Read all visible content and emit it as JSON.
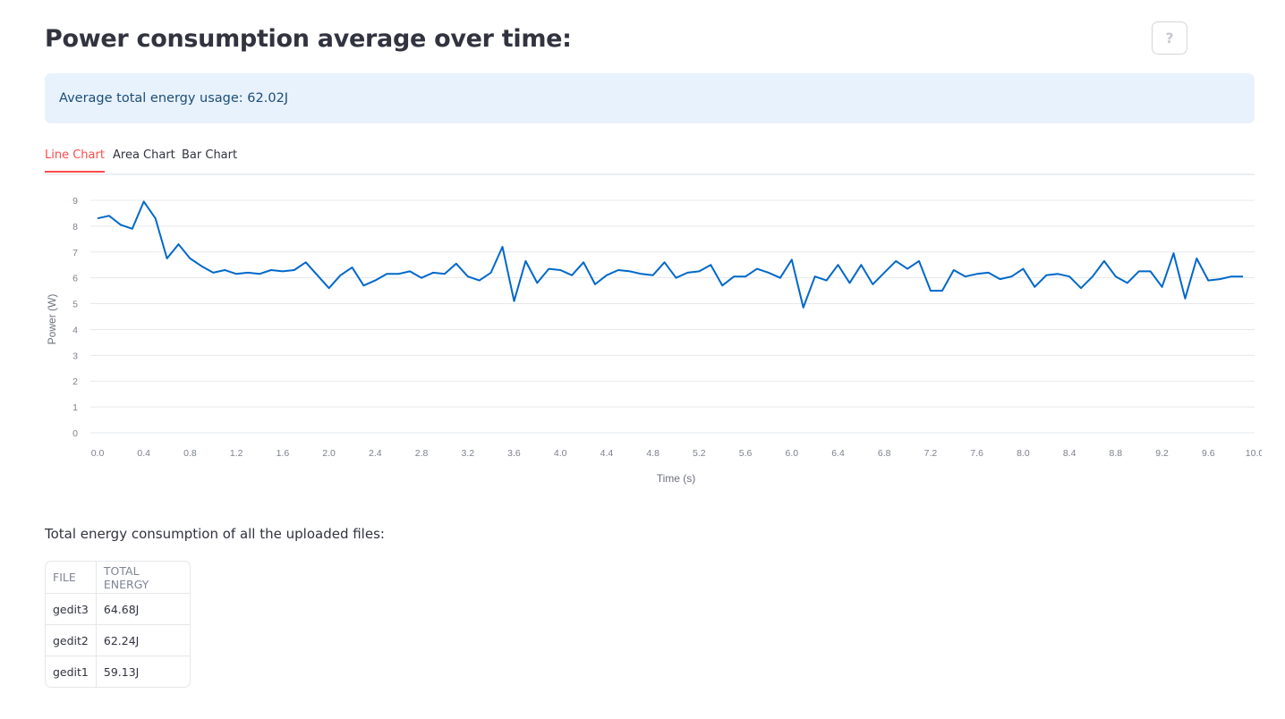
{
  "page": {
    "title": "Power consumption average over time:",
    "help_icon": "question-mark-icon",
    "help_label": "?"
  },
  "info": {
    "text": "Average total energy usage: 62.02J"
  },
  "tabs": [
    {
      "label": "Line Chart",
      "active": true
    },
    {
      "label": "Area Chart",
      "active": false
    },
    {
      "label": "Bar Chart",
      "active": false
    }
  ],
  "chart_data": {
    "type": "line",
    "xlabel": "Time (s)",
    "ylabel": "Power (W)",
    "xlim": [
      0,
      10
    ],
    "ylim": [
      0,
      9
    ],
    "x_ticks": [
      "0.0",
      "0.4",
      "0.8",
      "1.2",
      "1.6",
      "2.0",
      "2.4",
      "2.8",
      "3.2",
      "3.6",
      "4.0",
      "4.4",
      "4.8",
      "5.2",
      "5.6",
      "6.0",
      "6.4",
      "6.8",
      "7.2",
      "7.6",
      "8.0",
      "8.4",
      "8.8",
      "9.2",
      "9.6",
      "10.0"
    ],
    "y_ticks": [
      "0",
      "1",
      "2",
      "3",
      "4",
      "5",
      "6",
      "7",
      "8",
      "9"
    ],
    "grid": true,
    "color": "#0068c9",
    "series": [
      {
        "x": [
          0.0,
          0.1,
          0.2,
          0.3,
          0.4,
          0.5,
          0.6,
          0.7,
          0.8,
          0.9,
          1.0,
          1.1,
          1.2,
          1.3,
          1.4,
          1.5,
          1.6,
          1.7,
          1.8,
          1.9,
          2.0,
          2.1,
          2.2,
          2.3,
          2.4,
          2.5,
          2.6,
          2.7,
          2.8,
          2.9,
          3.0,
          3.1,
          3.2,
          3.3,
          3.4,
          3.5,
          3.6,
          3.7,
          3.8,
          3.9,
          4.0,
          4.1,
          4.2,
          4.3,
          4.4,
          4.5,
          4.6,
          4.7,
          4.8,
          4.9,
          5.0,
          5.1,
          5.2,
          5.3,
          5.4,
          5.5,
          5.6,
          5.7,
          5.8,
          5.9,
          6.0,
          6.1,
          6.2,
          6.3,
          6.4,
          6.5,
          6.6,
          6.7,
          6.8,
          6.9,
          7.0,
          7.1,
          7.2,
          7.3,
          7.4,
          7.5,
          7.6,
          7.7,
          7.8,
          7.9,
          8.0,
          8.1,
          8.2,
          8.3,
          8.4,
          8.5,
          8.6,
          8.7,
          8.8,
          8.9,
          9.0,
          9.1,
          9.2,
          9.3,
          9.4,
          9.5,
          9.6,
          9.7,
          9.8,
          9.9
        ],
        "values": [
          8.3,
          8.4,
          8.05,
          7.9,
          8.95,
          8.3,
          6.75,
          7.3,
          6.75,
          6.45,
          6.2,
          6.3,
          6.15,
          6.2,
          6.15,
          6.3,
          6.25,
          6.3,
          6.6,
          6.1,
          5.6,
          6.1,
          6.4,
          5.7,
          5.9,
          6.15,
          6.15,
          6.25,
          6.0,
          6.2,
          6.15,
          6.55,
          6.05,
          5.9,
          6.2,
          7.2,
          5.1,
          6.65,
          5.8,
          6.35,
          6.3,
          6.1,
          6.6,
          5.75,
          6.1,
          6.3,
          6.25,
          6.15,
          6.1,
          6.6,
          6.0,
          6.2,
          6.25,
          6.5,
          5.7,
          6.05,
          6.05,
          6.35,
          6.2,
          6.0,
          6.7,
          4.85,
          6.05,
          5.9,
          6.5,
          5.8,
          6.5,
          5.75,
          6.2,
          6.65,
          6.35,
          6.65,
          5.5,
          5.5,
          6.3,
          6.05,
          6.15,
          6.2,
          5.95,
          6.05,
          6.35,
          5.65,
          6.1,
          6.15,
          6.05,
          5.6,
          6.05,
          6.65,
          6.05,
          5.8,
          6.25,
          6.25,
          5.65,
          6.95,
          5.2,
          6.75,
          5.9,
          5.95,
          6.05,
          6.05
        ]
      }
    ]
  },
  "files_section": {
    "label": "Total energy consumption of all the uploaded files:"
  },
  "table": {
    "headers": [
      "FILE",
      "TOTAL ENERGY"
    ],
    "rows": [
      [
        "gedit3",
        "64.68J"
      ],
      [
        "gedit2",
        "62.24J"
      ],
      [
        "gedit1",
        "59.13J"
      ]
    ]
  }
}
